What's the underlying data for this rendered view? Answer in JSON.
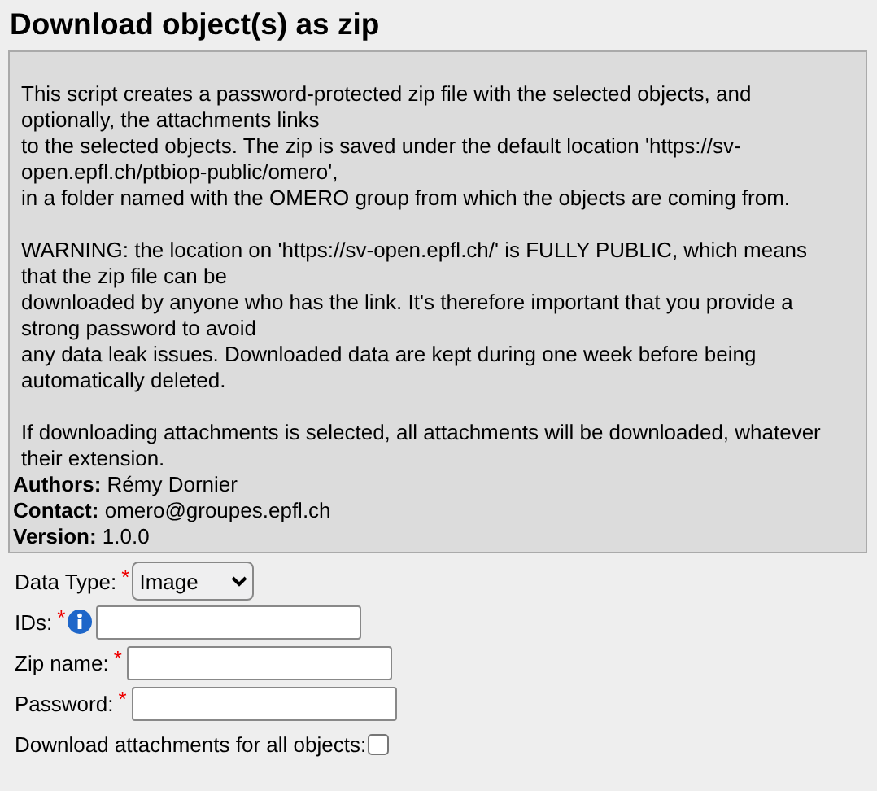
{
  "title": "Download object(s) as zip",
  "description": [
    [
      "This script creates a password-protected zip file with the selected objects, and",
      "optionally, the attachments links",
      "to the selected objects. The zip is saved under the default location 'https://sv-",
      "open.epfl.ch/ptbiop-public/omero',",
      "in a folder named with the OMERO group from which the objects are coming from."
    ],
    [
      "WARNING: the location on 'https://sv-open.epfl.ch/' is FULLY PUBLIC, which means",
      "that the zip file can be",
      "downloaded by anyone who has the link. It's therefore important that you provide a",
      "strong password to avoid",
      "any data leak issues. Downloaded data are kept during one week before being",
      "automatically deleted."
    ],
    [
      "If downloading attachments is selected, all attachments will be downloaded, whatever",
      "their extension."
    ]
  ],
  "meta": [
    {
      "label": "Authors:",
      "value": "Rémy Dornier"
    },
    {
      "label": "Contact:",
      "value": "omero@groupes.epfl.ch"
    },
    {
      "label": "Version:",
      "value": "1.0.0"
    }
  ],
  "fields": [
    {
      "kind": "select",
      "label": "Data Type:",
      "required_mark": "*",
      "value": "Image",
      "info": false
    },
    {
      "kind": "text",
      "label": "IDs:",
      "required_mark": "*",
      "info": true
    },
    {
      "kind": "text",
      "label": "Zip name:",
      "required_mark": "*",
      "info": false
    },
    {
      "kind": "text",
      "label": "Password:",
      "required_mark": "*",
      "info": false
    },
    {
      "kind": "checkbox",
      "label": "Download attachments for all objects:",
      "checked": false,
      "info": false
    }
  ]
}
